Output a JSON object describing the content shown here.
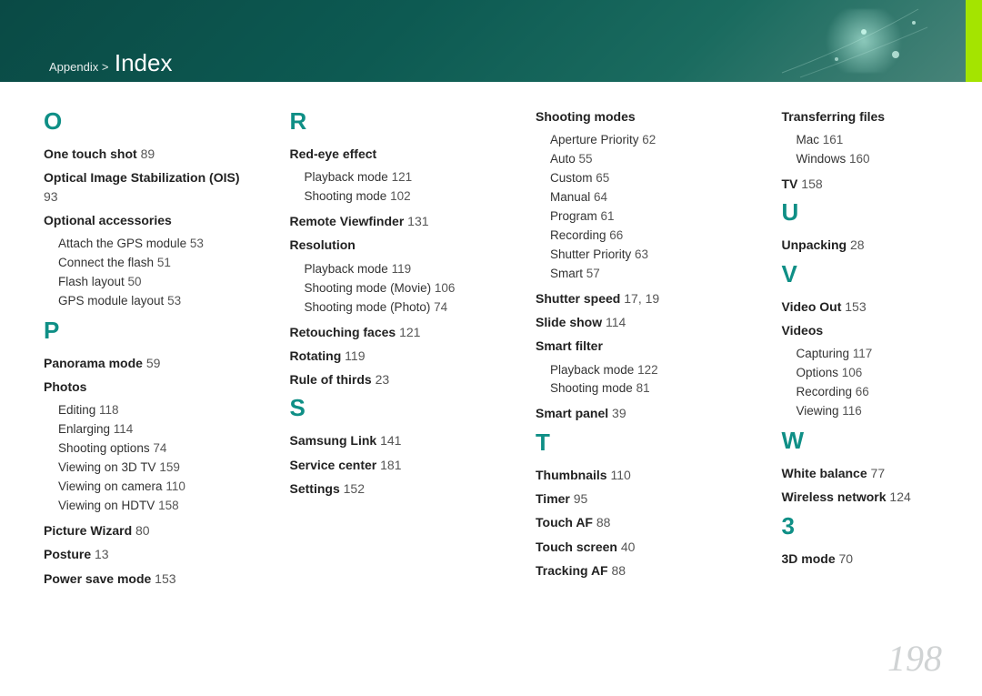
{
  "breadcrumb": {
    "prefix": "Appendix >",
    "title": "Index"
  },
  "page_number": "198",
  "columns": [
    {
      "groups": [
        {
          "letter": "O",
          "entries": [
            {
              "label": "One touch shot",
              "page": "89"
            },
            {
              "label": "Optical Image Stabilization (OIS)",
              "page": "93"
            },
            {
              "label": "Optional accessories",
              "sub": [
                {
                  "label": "Attach the GPS module",
                  "page": "53"
                },
                {
                  "label": "Connect the flash",
                  "page": "51"
                },
                {
                  "label": "Flash layout",
                  "page": "50"
                },
                {
                  "label": "GPS module layout",
                  "page": "53"
                }
              ]
            }
          ]
        },
        {
          "letter": "P",
          "entries": [
            {
              "label": "Panorama mode",
              "page": "59"
            },
            {
              "label": "Photos",
              "sub": [
                {
                  "label": "Editing",
                  "page": "118"
                },
                {
                  "label": "Enlarging",
                  "page": "114"
                },
                {
                  "label": "Shooting options",
                  "page": "74"
                },
                {
                  "label": "Viewing on 3D TV",
                  "page": "159"
                },
                {
                  "label": "Viewing on camera",
                  "page": "110"
                },
                {
                  "label": "Viewing on HDTV",
                  "page": "158"
                }
              ]
            },
            {
              "label": "Picture Wizard",
              "page": "80"
            },
            {
              "label": "Posture",
              "page": "13"
            },
            {
              "label": "Power save mode",
              "page": "153"
            }
          ]
        }
      ]
    },
    {
      "groups": [
        {
          "letter": "R",
          "entries": [
            {
              "label": "Red-eye effect",
              "sub": [
                {
                  "label": "Playback mode",
                  "page": "121"
                },
                {
                  "label": "Shooting mode",
                  "page": "102"
                }
              ]
            },
            {
              "label": "Remote Viewfinder",
              "page": "131"
            },
            {
              "label": "Resolution",
              "sub": [
                {
                  "label": "Playback mode",
                  "page": "119"
                },
                {
                  "label": "Shooting mode (Movie)",
                  "page": "106"
                },
                {
                  "label": "Shooting mode (Photo)",
                  "page": "74"
                }
              ]
            },
            {
              "label": "Retouching faces",
              "page": "121"
            },
            {
              "label": "Rotating",
              "page": "119"
            },
            {
              "label": "Rule of thirds",
              "page": "23"
            }
          ]
        },
        {
          "letter": "S",
          "entries": [
            {
              "label": "Samsung Link",
              "page": "141"
            },
            {
              "label": "Service center",
              "page": "181"
            },
            {
              "label": "Settings",
              "page": "152"
            }
          ]
        }
      ]
    },
    {
      "groups": [
        {
          "entries": [
            {
              "label": "Shooting modes",
              "sub": [
                {
                  "label": "Aperture Priority",
                  "page": "62"
                },
                {
                  "label": "Auto",
                  "page": "55"
                },
                {
                  "label": "Custom",
                  "page": "65"
                },
                {
                  "label": "Manual",
                  "page": "64"
                },
                {
                  "label": "Program",
                  "page": "61"
                },
                {
                  "label": "Recording",
                  "page": "66"
                },
                {
                  "label": "Shutter Priority",
                  "page": "63"
                },
                {
                  "label": "Smart",
                  "page": "57"
                }
              ]
            },
            {
              "label": "Shutter speed",
              "page": "17, 19"
            },
            {
              "label": "Slide show",
              "page": "114"
            },
            {
              "label": "Smart filter",
              "sub": [
                {
                  "label": "Playback mode",
                  "page": "122"
                },
                {
                  "label": "Shooting mode",
                  "page": "81"
                }
              ]
            },
            {
              "label": "Smart panel",
              "page": "39"
            }
          ]
        },
        {
          "letter": "T",
          "entries": [
            {
              "label": "Thumbnails",
              "page": "110"
            },
            {
              "label": "Timer",
              "page": "95"
            },
            {
              "label": "Touch AF",
              "page": "88"
            },
            {
              "label": "Touch screen",
              "page": "40"
            },
            {
              "label": "Tracking AF",
              "page": "88"
            }
          ]
        }
      ]
    },
    {
      "groups": [
        {
          "entries": [
            {
              "label": "Transferring files",
              "sub": [
                {
                  "label": "Mac",
                  "page": "161"
                },
                {
                  "label": "Windows",
                  "page": "160"
                }
              ]
            },
            {
              "label": "TV",
              "page": "158"
            }
          ]
        },
        {
          "letter": "U",
          "entries": [
            {
              "label": "Unpacking",
              "page": "28"
            }
          ]
        },
        {
          "letter": "V",
          "entries": [
            {
              "label": "Video Out",
              "page": "153"
            },
            {
              "label": "Videos",
              "sub": [
                {
                  "label": "Capturing",
                  "page": "117"
                },
                {
                  "label": "Options",
                  "page": "106"
                },
                {
                  "label": "Recording",
                  "page": "66"
                },
                {
                  "label": "Viewing",
                  "page": "116"
                }
              ]
            }
          ]
        },
        {
          "letter": "W",
          "entries": [
            {
              "label": "White balance",
              "page": "77"
            },
            {
              "label": "Wireless network",
              "page": "124"
            }
          ]
        },
        {
          "letter": "3",
          "entries": [
            {
              "label": "3D mode",
              "page": "70"
            }
          ]
        }
      ]
    }
  ]
}
